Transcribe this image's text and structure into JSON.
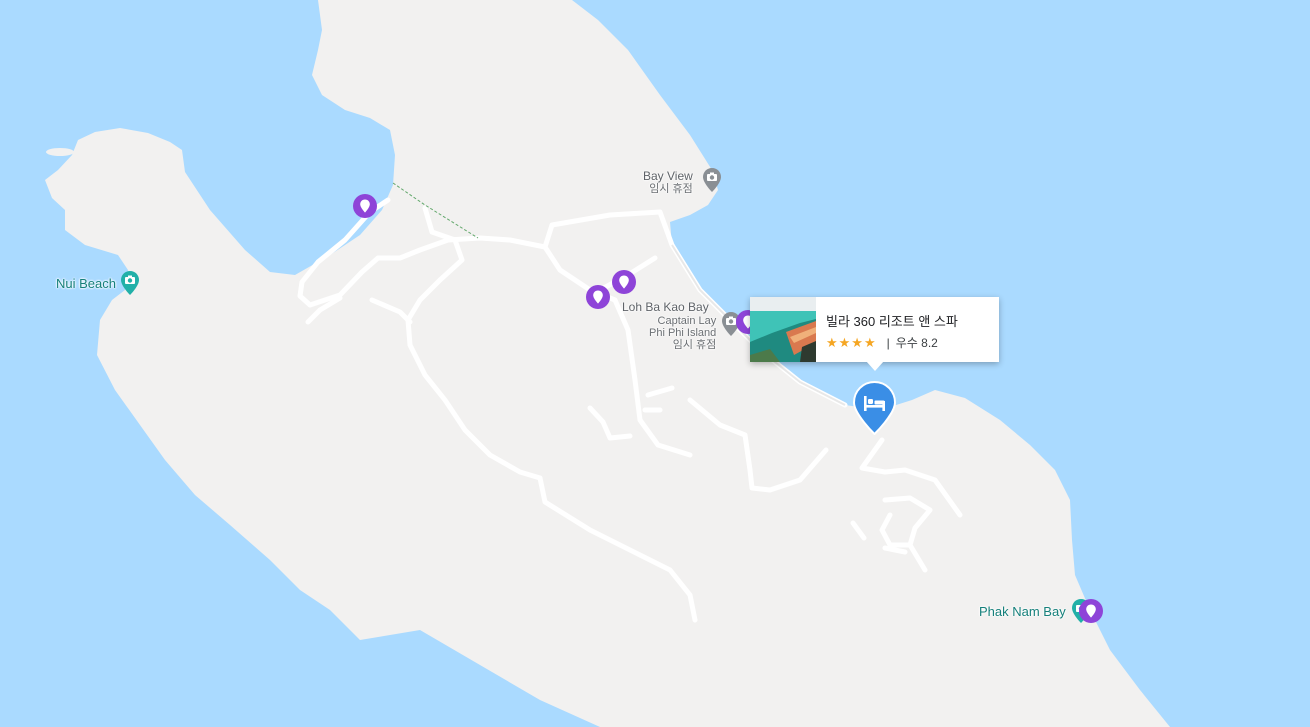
{
  "map": {
    "colors": {
      "water": "#aadaff",
      "land": "#f2f1f0",
      "road": "#ffffff",
      "purple_poi": "#8e44d8",
      "teal_poi": "#16807b",
      "hotel_marker": "#3a8ee6",
      "star": "#f5a623"
    },
    "labels": {
      "bay_view": {
        "name": "Bay View",
        "status": "임시 휴점"
      },
      "nui_beach": {
        "name": "Nui Beach"
      },
      "loh_ba_kao": {
        "name": "Loh Ba Kao Bay"
      },
      "captain_lay": {
        "name_line1": "Captain Lay",
        "name_line2": "Phi Phi Island",
        "status": "임시 휴점"
      },
      "phak_nam": {
        "name": "Phak Nam Bay"
      }
    },
    "info_card": {
      "title": "빌라 360 리조트 앤 스파",
      "stars": "★★★★",
      "rating_text": "우수 8.2",
      "separator": "|"
    },
    "icons": [
      "camera-icon",
      "location-pin-icon",
      "bed-icon",
      "star-icon"
    ]
  }
}
